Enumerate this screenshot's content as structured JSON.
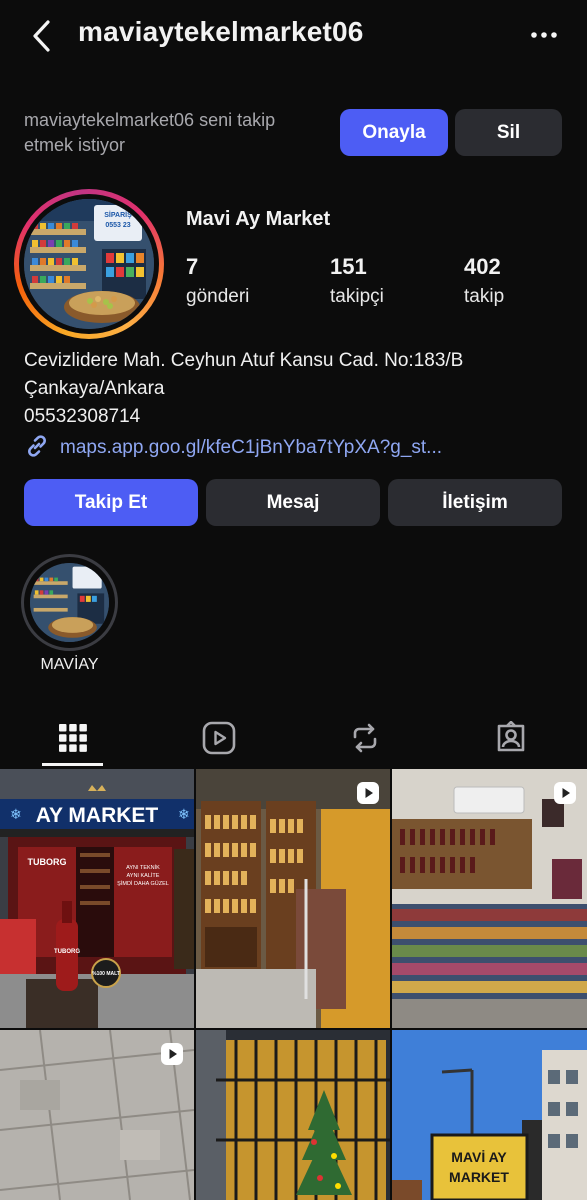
{
  "header": {
    "username": "maviaytekelmarket06",
    "back_icon": "chevron-left-icon",
    "more_icon": "more-horizontal-icon"
  },
  "follow_request": {
    "text": "maviaytekelmarket06 seni takip etmek istiyor",
    "approve_label": "Onayla",
    "delete_label": "Sil"
  },
  "profile": {
    "name": "Mavi Ay Market",
    "stats": [
      {
        "value": "7",
        "label": "gönderi"
      },
      {
        "value": "151",
        "label": "takipçi"
      },
      {
        "value": "402",
        "label": "takip"
      }
    ],
    "bio_lines": [
      "Cevizlidere Mah. Ceyhun Atuf Kansu Cad. No:183/B",
      "Çankaya/Ankara",
      "05532308714"
    ],
    "link": "maps.app.goo.gl/kfeC1jBnYba7tYpXA?g_st..."
  },
  "actions": {
    "follow_label": "Takip Et",
    "message_label": "Mesaj",
    "contact_label": "İletişim"
  },
  "highlights": [
    {
      "label": "MAVİAY"
    }
  ],
  "tabs": [
    {
      "icon": "grid-icon",
      "active": true
    },
    {
      "icon": "reels-icon",
      "active": false
    },
    {
      "icon": "repost-icon",
      "active": false
    },
    {
      "icon": "tagged-icon",
      "active": false
    }
  ],
  "posts": {
    "store_sign": "AY MARKET",
    "sign_2": "MAVİ AY",
    "sign_3": "MARKET",
    "poster_1": "TUBORG",
    "poster_2": "AYNI TEKNİK",
    "poster_3": "AYNI KALİTE",
    "poster_4": "ŞİMDİ DAHA GÜZEL",
    "bottle_label": "TUBORG",
    "malt": "%100 MALT",
    "items": [
      {
        "type": "photo"
      },
      {
        "type": "reel"
      },
      {
        "type": "reel"
      },
      {
        "type": "reel"
      },
      {
        "type": "photo"
      },
      {
        "type": "photo"
      }
    ]
  },
  "colors": {
    "primary_button": "#4d5df4",
    "secondary_button": "#2b2c31",
    "link": "#8fa7f2",
    "background": "#0c0c0c"
  }
}
